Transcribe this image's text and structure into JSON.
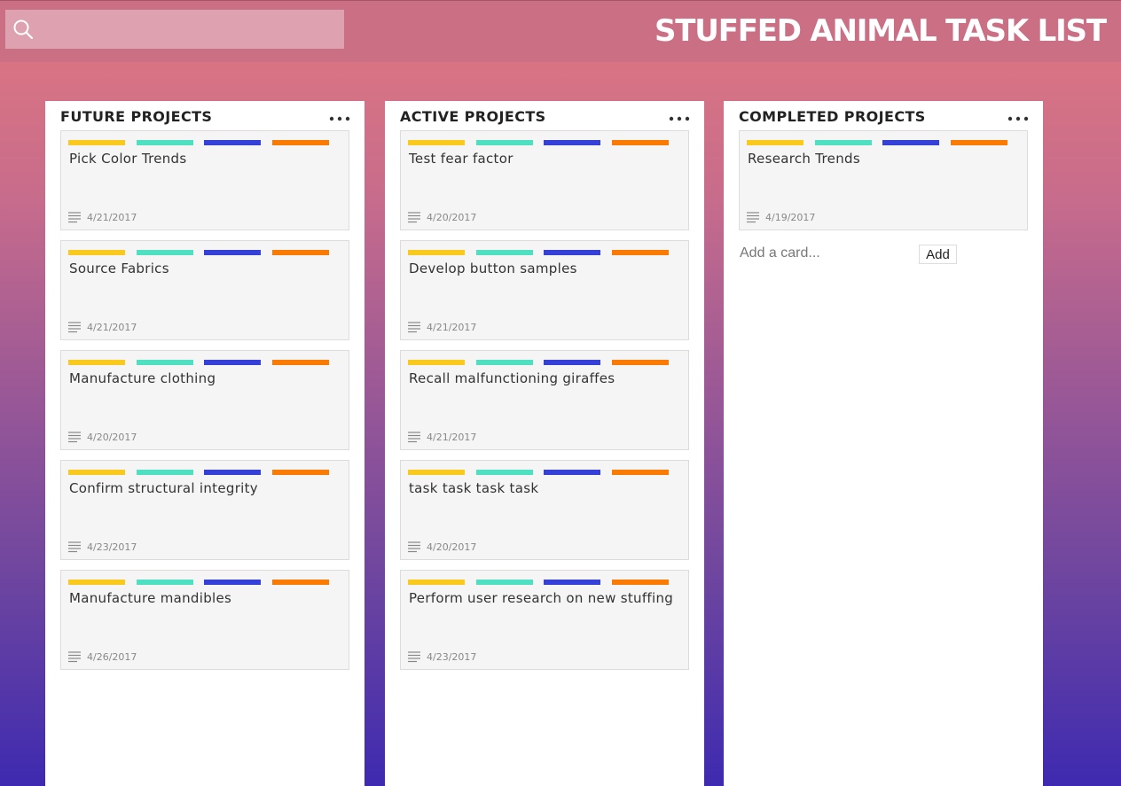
{
  "header": {
    "title": "STUFFED ANIMAL TASK LIST",
    "search": {
      "placeholder": "",
      "value": ""
    }
  },
  "colors": {
    "label_yellow": "#f9c91e",
    "label_teal": "#4fe0c2",
    "label_blue": "#3440d8",
    "label_orange": "#fb7a02",
    "header_bg": "#cb6f85",
    "gradient_top": "#e0777f",
    "gradient_bottom": "#3e2ab0"
  },
  "icons": {
    "search": "search-icon",
    "column_menu": "more-horizontal-icon",
    "card_description": "description-lines-icon"
  },
  "columns": [
    {
      "title": "FUTURE PROJECTS",
      "cards": [
        {
          "title": "Pick Color Trends",
          "date": "4/21/2017"
        },
        {
          "title": "Source Fabrics",
          "date": "4/21/2017"
        },
        {
          "title": "Manufacture clothing",
          "date": "4/20/2017"
        },
        {
          "title": "Confirm structural integrity",
          "date": "4/23/2017"
        },
        {
          "title": "Manufacture mandibles",
          "date": "4/26/2017"
        }
      ]
    },
    {
      "title": "ACTIVE PROJECTS",
      "cards": [
        {
          "title": "Test fear factor",
          "date": "4/20/2017"
        },
        {
          "title": "Develop button samples",
          "date": "4/21/2017"
        },
        {
          "title": "Recall malfunctioning giraffes",
          "date": "4/21/2017"
        },
        {
          "title": "task task task task",
          "date": "4/20/2017"
        },
        {
          "title": "Perform user research on new stuffing",
          "date": "4/23/2017"
        }
      ]
    },
    {
      "title": "COMPLETED PROJECTS",
      "cards": [
        {
          "title": "Research Trends",
          "date": "4/19/2017"
        }
      ],
      "add_card": {
        "placeholder": "Add a card...",
        "button_label": "Add"
      }
    }
  ]
}
